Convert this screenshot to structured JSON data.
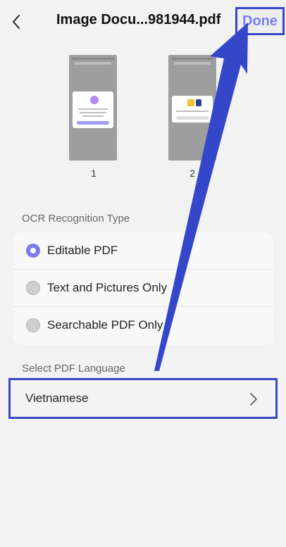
{
  "header": {
    "title": "Image Docu...981944.pdf",
    "done_label": "Done"
  },
  "pages": [
    {
      "number": "1"
    },
    {
      "number": "2"
    }
  ],
  "ocr": {
    "section_title": "OCR Recognition Type",
    "options": [
      {
        "label": "Editable PDF",
        "selected": true
      },
      {
        "label": "Text and Pictures Only",
        "selected": false
      },
      {
        "label": "Searchable PDF Only",
        "selected": false
      }
    ]
  },
  "language": {
    "section_title": "Select PDF Language",
    "value": "Vietnamese"
  },
  "colors": {
    "accent": "#7e79ee",
    "annotation": "#3548c6",
    "background": "#f2f2f2"
  },
  "icons": {
    "back": "chevron-left-icon",
    "row_arrow": "chevron-right-icon"
  }
}
